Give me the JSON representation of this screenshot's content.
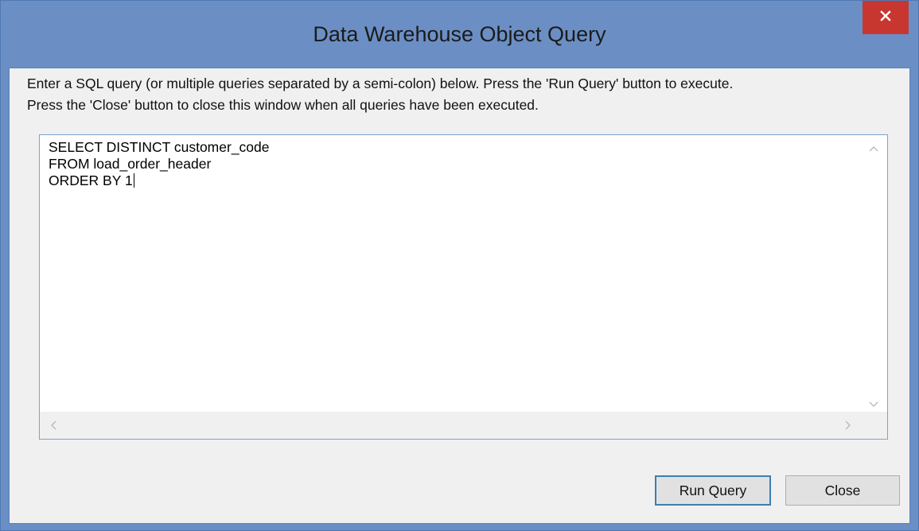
{
  "window": {
    "title": "Data Warehouse Object Query"
  },
  "instructions": {
    "line1": "Enter a SQL query (or multiple queries separated by a semi-colon) below. Press the 'Run Query' button to execute.",
    "line2": "Press the 'Close' button to close this window when all queries have been executed."
  },
  "editor": {
    "lines": [
      "SELECT DISTINCT customer_code",
      "FROM load_order_header",
      "ORDER BY 1"
    ]
  },
  "buttons": {
    "run_query": "Run Query",
    "close": "Close"
  },
  "icons": {
    "close": "close-icon",
    "scroll_up": "chevron-up-icon",
    "scroll_down": "chevron-down-icon",
    "scroll_left": "chevron-left-icon",
    "scroll_right": "chevron-right-icon"
  },
  "colors": {
    "titlebar": "#6b8fc4",
    "close_button": "#c7372f",
    "client_bg": "#f0f0f0",
    "editor_border": "#7da2ce",
    "default_button_border": "#3c7fb1"
  }
}
